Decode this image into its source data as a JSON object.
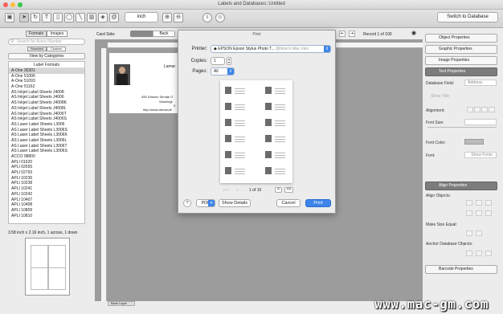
{
  "window": {
    "title": "Labels and Databases::Untitled"
  },
  "toolbar": {
    "zoom_unit": "inch",
    "switch_label": "Switch to Database"
  },
  "left_panel": {
    "tabs": [
      "Formats",
      "Images"
    ],
    "subtabs": [
      "Standard",
      "Custom"
    ],
    "search_placeholder": "Search for Avery Number",
    "categories_button": "View by Categories",
    "list_header": "Label Formats",
    "items": [
      "A-One 30301",
      "A-One 51006",
      "A-One 51093",
      "A-One 51162",
      "AS Inkjet Label Sheets J4008",
      "AS Inkjet Label Sheets J4006",
      "AS Inkjet Label Sheets J4008K",
      "AS Inkjet Label Sheets J4008L",
      "AS Inkjet Label Sheets J4006T",
      "AS Inkjet Label Sheets J4006S",
      "AS Laser Label Sheets L3006",
      "AS Laser Label Sheets L3006S",
      "AS Laser Label Sheets L3006K",
      "AS Laser Label Sheets L3006L",
      "AS Laser Label Sheets L3006T",
      "AS Laser Label Sheets L3006S",
      "ACCO 98800",
      "APLI 01620",
      "APLI 02655",
      "APLI 02793",
      "APLI 10235",
      "APLI 10238",
      "APLI 10241",
      "APLI 10242",
      "APLI 10407",
      "APLI 10408",
      "APLI 10809",
      "APLI 10810"
    ],
    "selected_index": 0,
    "size_info": "3.58 inch x 2.16 inch, 1 across, 1 down"
  },
  "card_side": {
    "label": "Card Side:",
    "front": "Front",
    "back": "Back",
    "record": "Record 1 of 100"
  },
  "card": {
    "name": "Lamar",
    "address": "455 Dirksen Senate O",
    "city": "Washingt",
    "extra": "0",
    "url": "http://www.alexande"
  },
  "bottom_tab": "Back Layer",
  "right_panel": {
    "object_properties": "Object Properties",
    "graphic_properties": "Graphic Properties",
    "image_properties": "Image Properties",
    "text_properties": "Text Properties",
    "database_field_label": "Database Field:",
    "database_field_value": "Address",
    "show_title": "Show Title",
    "alignment": "Alignment:",
    "font_size": "Font Size:",
    "font_color": "Font Color:",
    "font": "Font:",
    "show_fonts": "Show Fonts",
    "align_properties": "Align Properties",
    "align_objects": "Align Objects:",
    "make_size_equal": "Make Size Equal:",
    "anchor_objects": "Anchor Database Objects:",
    "barcode_properties": "Barcode Properties"
  },
  "print_dialog": {
    "title": "Print",
    "printer_label": "Printer:",
    "printer_value": "EPSON Epson Stylus Photo T...",
    "printer_suffix": "@himo's Mac mini",
    "copies_label": "Copies:",
    "copies_value": "1",
    "pages_label": "Pages:",
    "pages_value": "All",
    "page_indicator": "1 of 10",
    "help": "?",
    "pdf": "PDF",
    "show_details": "Show Details",
    "cancel": "Cancel",
    "print": "Print"
  },
  "watermark": "www.mac-gm.com"
}
